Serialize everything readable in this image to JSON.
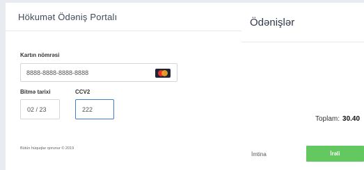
{
  "left": {
    "title": "Hökumət Ödəniş Portalı",
    "card_label": "Kartın nömrəsi",
    "card_value": "8888-8888-8888-8888",
    "card_icon": "mastercard-icon",
    "expiry_label": "Bitmə tarixi",
    "expiry_value": "02 / 23",
    "cvv_label": "CCV2",
    "cvv_value": "222",
    "copyright": "Bütün hüquqlar qorunur © 2019"
  },
  "right": {
    "title": "Ödənişlər",
    "total_label": "Toplam:",
    "total_value": "30.40",
    "cancel_label": "İmtina",
    "next_label": "İrəli"
  },
  "colors": {
    "background": "#e8ebf0",
    "next_button": "#62c85f",
    "focus_border": "#3f7fc8"
  }
}
